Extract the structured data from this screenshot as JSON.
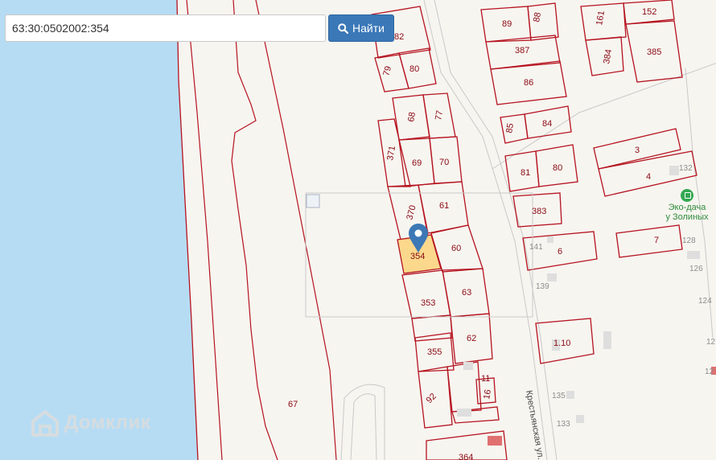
{
  "search": {
    "value": "63:30:0502002:354",
    "button_label": "Найти"
  },
  "parcels": {
    "p82": "82",
    "p79": "79",
    "p80a": "80",
    "p89": "89",
    "p88": "88",
    "p161": "161",
    "p152": "152",
    "p387": "387",
    "p384": "384",
    "p385": "385",
    "p86": "86",
    "p68": "68",
    "p77": "77",
    "p371": "371",
    "p69": "69",
    "p70": "70",
    "p85": "85",
    "p84": "84",
    "p81": "81",
    "p80b": "80",
    "p3": "3",
    "p4": "4",
    "p132": "132",
    "p370": "370",
    "p61": "61",
    "p383": "383",
    "p354": "354",
    "p60": "60",
    "p141": "141",
    "p6": "6",
    "p7": "7",
    "p128": "128",
    "p126": "126",
    "p353": "353",
    "p63": "63",
    "p139": "139",
    "p124": "124",
    "p355": "355",
    "p62": "62",
    "p110": "1.10",
    "p12a": "12",
    "p12b": "12",
    "p11": "11",
    "p16": "16",
    "p92": "92",
    "p135": "135",
    "p133": "133",
    "p67": "67",
    "p364": "364"
  },
  "street_label": "Крестьянская ул.",
  "poi": {
    "name_line1": "Эко-дача",
    "name_line2": "у Золиных",
    "icon": "shop-icon"
  },
  "logo": {
    "name": "Домклик",
    "icon": "house-logo-icon"
  },
  "colors": {
    "water": "#b6dcf4",
    "parcel_border": "#b5131f",
    "selected_fill": "#fbd27a",
    "marker": "#3c78b5",
    "button": "#3a78b8",
    "poi": "#33a852"
  }
}
